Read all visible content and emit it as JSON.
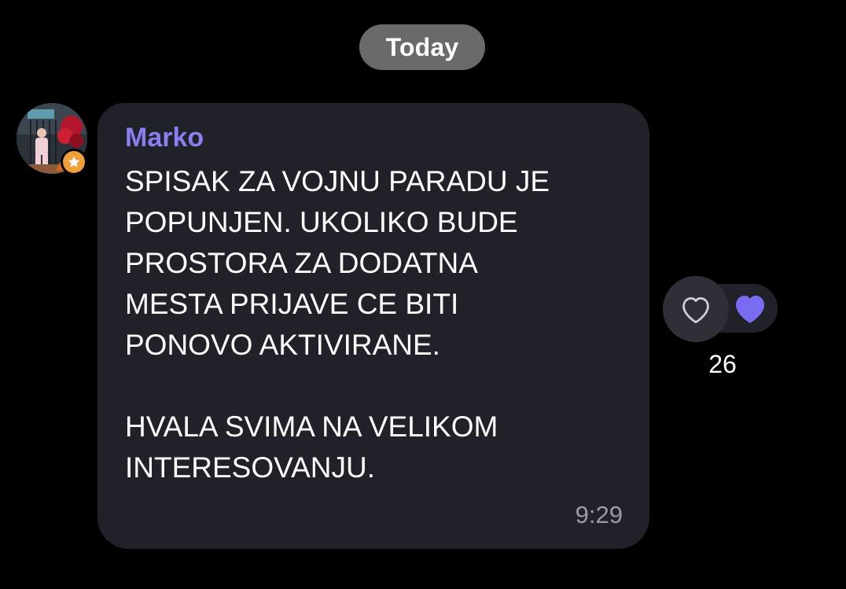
{
  "date_separator": "Today",
  "message": {
    "sender": "Marko",
    "text": "SPISAK ZA VOJNU PARADU JE\nPOPUNJEN. UKOLIKO BUDE\nPROSTORA ZA DODATNA\nMESTA PRIJAVE CE BITI\nPONOVO AKTIVIRANE.\n\nHVALA SVIMA NA VELIKOM\nINTERESOVANJU.",
    "time": "9:29"
  },
  "reaction": {
    "icon": "heart-icon",
    "count": "26"
  },
  "colors": {
    "background": "#000000",
    "bubble": "#212229",
    "sender": "#8b7ff0",
    "date_pill": "#6a6a6c",
    "badge": "#f0a03a",
    "reaction_heart": "#7a6cf2"
  }
}
